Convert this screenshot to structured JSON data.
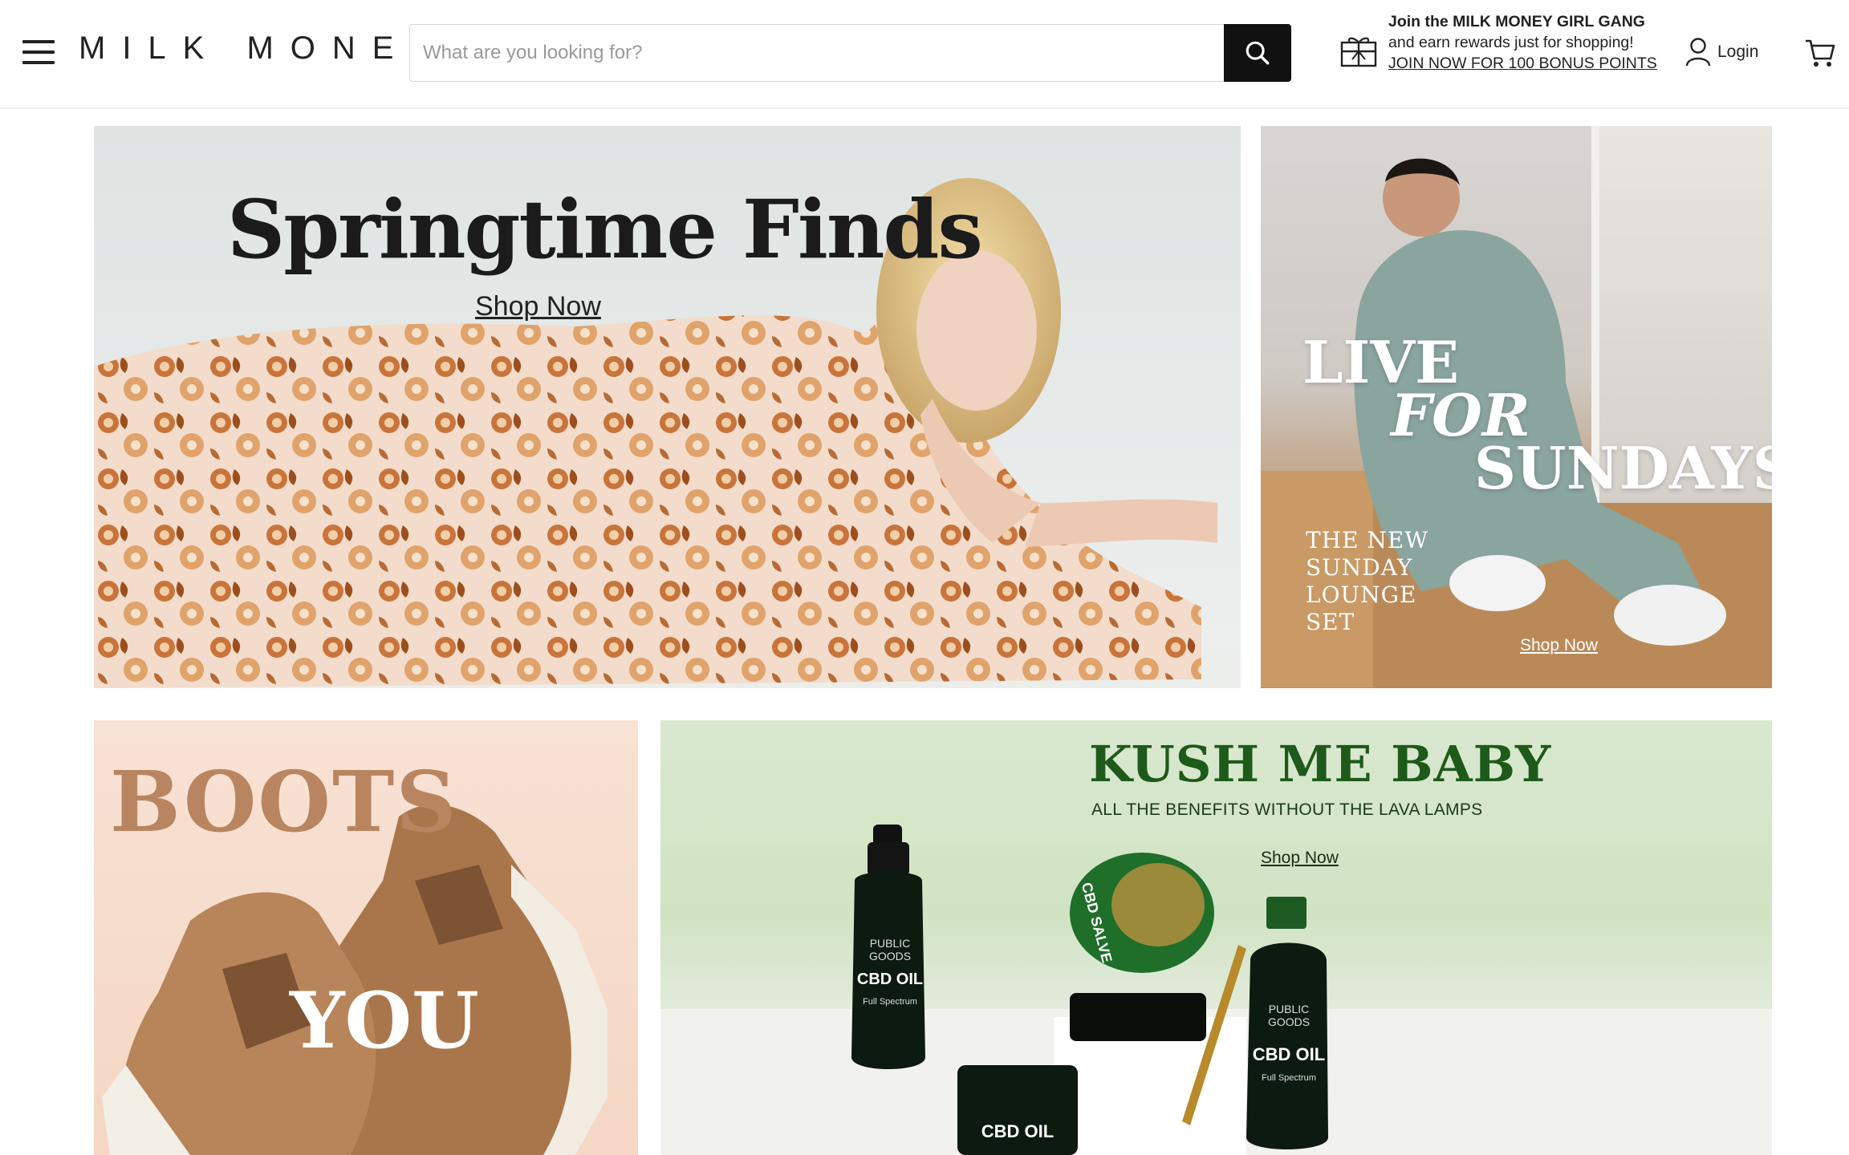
{
  "header": {
    "logo_text": "MILK MONEY",
    "search": {
      "placeholder": "What are you looking for?",
      "value": ""
    },
    "rewards": {
      "line_strong": "Join the MILK MONEY GIRL GANG",
      "line_text": "and earn rewards just for shopping!",
      "link_text": "JOIN NOW FOR 100 BONUS POINTS"
    },
    "login_label": "Login"
  },
  "banners": {
    "springtime": {
      "title": "Springtime Finds",
      "cta": "Shop Now"
    },
    "sundays": {
      "line1": "LIVE",
      "line2": "FOR",
      "line3": "SUNDAYS",
      "subtitle": "THE NEW SUNDAY LOUNGE SET",
      "cta": "Shop Now"
    },
    "boots": {
      "line1": "BOOTS",
      "line2": "YOU"
    },
    "kush": {
      "title": "KUSH ME BABY",
      "subtitle": "ALL THE BENEFITS WITHOUT THE LAVA LAMPS",
      "cta": "Shop Now",
      "product_labels": {
        "brand": "PUBLIC GOODS",
        "oil": "CBD OIL",
        "salve": "CBD SALVE",
        "spectrum": "Full Spectrum"
      }
    }
  },
  "colors": {
    "kush_green": "#1e5a1a",
    "boots_tan": "#b98560",
    "search_button": "#111111"
  }
}
